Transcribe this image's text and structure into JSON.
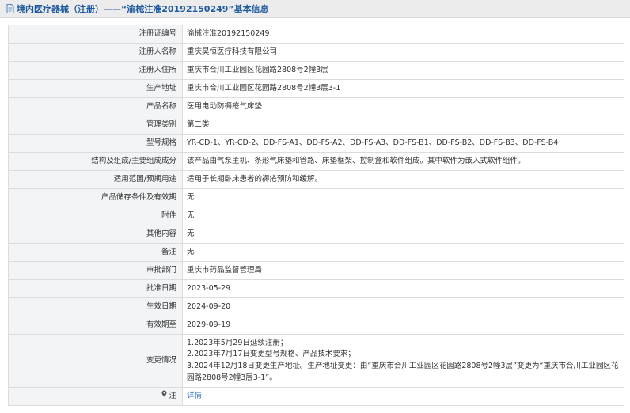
{
  "header": {
    "icon": "document-icon",
    "title": "境内医疗器械（注册）——“渝械注准20192150249”基本信息"
  },
  "rows": [
    {
      "label": "注册证编号",
      "value": "渝械注准20192150249"
    },
    {
      "label": "注册人名称",
      "value": "重庆昊恒医疗科技有限公司"
    },
    {
      "label": "注册人住所",
      "value": "重庆市合川工业园区花园路2808号2幢3层"
    },
    {
      "label": "生产地址",
      "value": "重庆市合川工业园区花园路2808号2幢3层3-1"
    },
    {
      "label": "产品名称",
      "value": "医用电动防褥疮气床垫"
    },
    {
      "label": "管理类别",
      "value": "第二类"
    },
    {
      "label": "型号规格",
      "value": "YR-CD-1、YR-CD-2、DD-FS-A1、DD-FS-A2、DD-FS-A3、DD-FS-B1、DD-FS-B2、DD-FS-B3、DD-FS-B4"
    },
    {
      "label": "结构及组成/主要组成成分",
      "value": "该产品由气泵主机、条形气床垫和管路、床垫框架、控制盒和软件组成。其中软件为嵌入式软件组件。"
    },
    {
      "label": "适用范围/预期用途",
      "value": "适用于长期卧床患者的褥疮预防和缓解。"
    },
    {
      "label": "产品储存条件及有效期",
      "value": "无"
    },
    {
      "label": "附件",
      "value": "无"
    },
    {
      "label": "其他内容",
      "value": "无"
    },
    {
      "label": "备注",
      "value": "无"
    },
    {
      "label": "审批部门",
      "value": "重庆市药品监督管理局"
    },
    {
      "label": "批准日期",
      "value": "2023-05-29"
    },
    {
      "label": "生效日期",
      "value": "2024-09-20"
    },
    {
      "label": "有效期至",
      "value": "2029-09-19"
    }
  ],
  "changes": {
    "label": "变更情况",
    "lines": [
      "1.2023年5月29日延续注册；",
      "2.2023年7月17日变更型号规格、产品技术要求；",
      "3.2024年12月18日变更生产地址。生产地址变更：由“重庆市合川工业园区花园路2808号2幢3层”变更为“重庆市合川工业园区花园路2808号2幢3层3-1”。"
    ]
  },
  "detail": {
    "label": "注",
    "icon": "map-pin-icon",
    "link_text": "详情"
  }
}
